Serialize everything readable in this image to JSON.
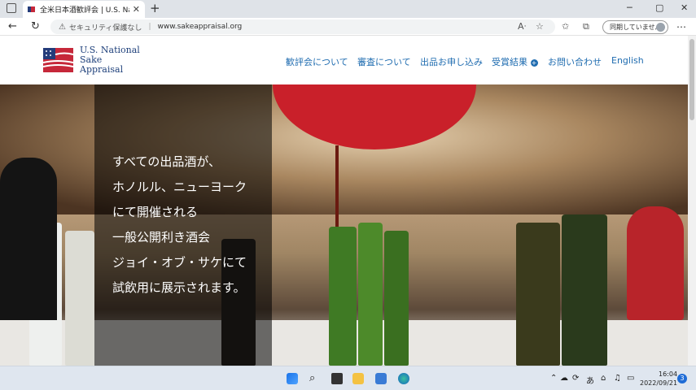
{
  "browser": {
    "tab_title": "全米日本酒歓評会 | U.S. Nationa",
    "tab_close": "✕",
    "new_tab": "+",
    "security_label": "セキュリティ保護なし",
    "url": "www.sakeappraisal.org",
    "profile_label": "同期していません",
    "win_min": "─",
    "win_max": "▢",
    "win_close": "✕"
  },
  "site": {
    "logo_line1": "U.S. National",
    "logo_line2": "Sake",
    "logo_line3": "Appraisal",
    "nav": [
      "歓評会について",
      "審査について",
      "出品お申し込み",
      "受賞結果",
      "お問い合わせ",
      "English"
    ]
  },
  "hero": {
    "lines": [
      "すべての出品酒が、",
      "ホノルル、ニューヨーク",
      "にて開催される",
      "一般公開利き酒会",
      "ジョイ・オブ・サケにて",
      "試飲用に展示されます。"
    ]
  },
  "taskbar": {
    "time": "16:04",
    "date": "2022/09/21",
    "ime": "あ",
    "notifications": "3"
  },
  "colors": {
    "brand_blue": "#1d3f7a",
    "nav_blue": "#1f6cb0",
    "flag_red": "#c6283a"
  }
}
